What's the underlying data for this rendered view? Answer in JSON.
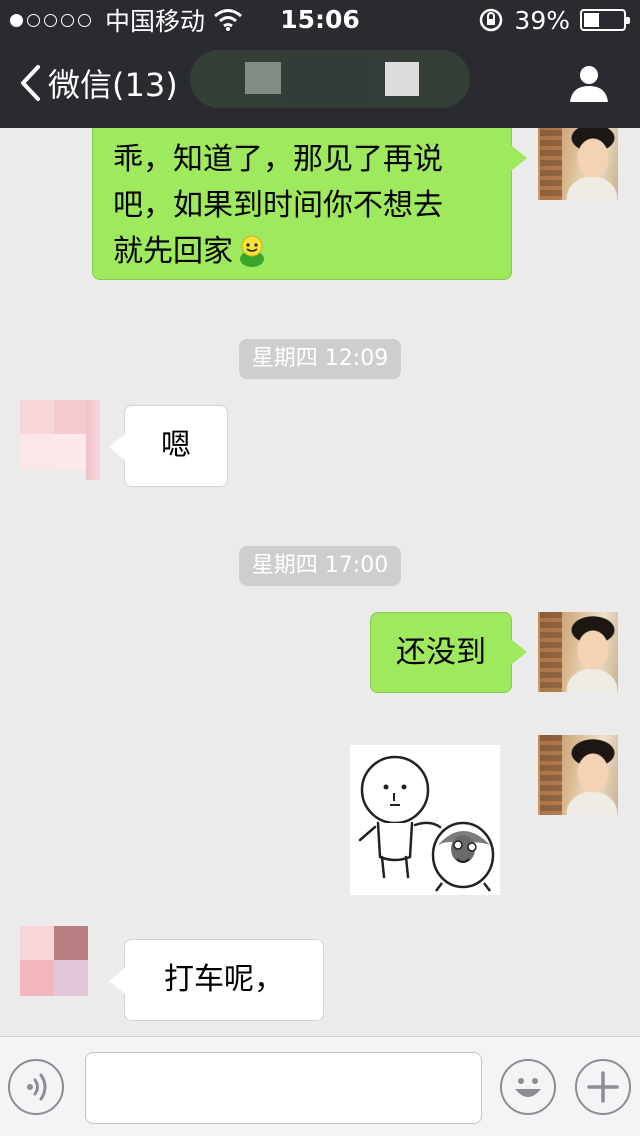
{
  "status_bar": {
    "carrier": "中国移动",
    "time": "15:06",
    "battery": "39%",
    "battery_level": 0.39,
    "signal_bars_filled": 1,
    "signal_bars_total": 5
  },
  "nav": {
    "back_label": "微信(13)",
    "back_icon": "chevron-left-icon",
    "profile_icon": "person-icon"
  },
  "messages": [
    {
      "sender": "me",
      "type": "text",
      "text_lines": [
        "乖，知道了，那见了再说",
        "吧，如果到时间你不想去",
        "就先回家"
      ],
      "emoji": "smile-emoji"
    },
    {
      "type": "timestamp",
      "text": "星期四 12:09"
    },
    {
      "sender": "other",
      "type": "text",
      "text": "嗯"
    },
    {
      "type": "timestamp",
      "text": "星期四 17:00"
    },
    {
      "sender": "me",
      "type": "text",
      "text": "还没到"
    },
    {
      "sender": "me",
      "type": "sticker",
      "sticker": "cartoon-sticker"
    },
    {
      "sender": "other",
      "type": "text",
      "text": "打车呢，"
    }
  ],
  "input_bar": {
    "voice_icon": "voice-icon",
    "emoji_icon": "emoji-icon",
    "plus_icon": "plus-icon",
    "input_value": ""
  },
  "colors": {
    "nav_bg": "#2a2b30",
    "chat_bg": "#ebebeb",
    "my_bubble": "#9ee95e",
    "other_bubble": "#ffffff",
    "timestamp_bg": "#cecece"
  }
}
